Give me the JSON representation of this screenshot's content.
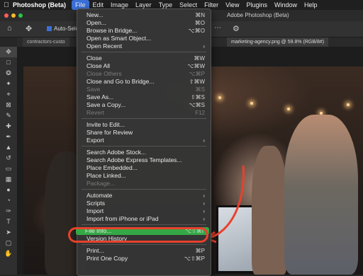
{
  "menubar": {
    "app_name": "Photoshop (Beta)",
    "items": [
      "File",
      "Edit",
      "Image",
      "Layer",
      "Type",
      "Select",
      "Filter",
      "View",
      "Plugins",
      "Window",
      "Help"
    ]
  },
  "window_title": "Adobe Photoshop (Beta)",
  "options_bar": {
    "auto_select_label": "Auto-Selec"
  },
  "tabs": [
    {
      "label": "contractors-custo"
    },
    {
      "label": "marketing-agency.png @ 59.8% (RGB/8#)"
    }
  ],
  "file_menu": {
    "groups": [
      [
        {
          "label": "New...",
          "shortcut": "⌘N"
        },
        {
          "label": "Open...",
          "shortcut": "⌘O"
        },
        {
          "label": "Browse in Bridge...",
          "shortcut": "⌥⌘O"
        },
        {
          "label": "Open as Smart Object...",
          "shortcut": ""
        },
        {
          "label": "Open Recent",
          "shortcut": "›"
        }
      ],
      [
        {
          "label": "Close",
          "shortcut": "⌘W"
        },
        {
          "label": "Close All",
          "shortcut": "⌥⌘W"
        },
        {
          "label": "Close Others",
          "shortcut": "⌥⌘P",
          "disabled": true
        },
        {
          "label": "Close and Go to Bridge...",
          "shortcut": "⇧⌘W"
        },
        {
          "label": "Save",
          "shortcut": "⌘S",
          "disabled": true
        },
        {
          "label": "Save As...",
          "shortcut": "⇧⌘S"
        },
        {
          "label": "Save a Copy...",
          "shortcut": "⌥⌘S"
        },
        {
          "label": "Revert",
          "shortcut": "F12",
          "disabled": true
        }
      ],
      [
        {
          "label": "Invite to Edit...",
          "shortcut": ""
        },
        {
          "label": "Share for Review",
          "shortcut": ""
        },
        {
          "label": "Export",
          "shortcut": "›"
        }
      ],
      [
        {
          "label": "Search Adobe Stock...",
          "shortcut": ""
        },
        {
          "label": "Search Adobe Express Templates...",
          "shortcut": ""
        },
        {
          "label": "Place Embedded...",
          "shortcut": ""
        },
        {
          "label": "Place Linked...",
          "shortcut": ""
        },
        {
          "label": "Package...",
          "shortcut": "",
          "disabled": true
        }
      ],
      [
        {
          "label": "Automate",
          "shortcut": "›"
        },
        {
          "label": "Scripts",
          "shortcut": "›"
        },
        {
          "label": "Import",
          "shortcut": "›"
        },
        {
          "label": "Import from iPhone or iPad",
          "shortcut": "›"
        }
      ],
      [
        {
          "label": "File Info...",
          "shortcut": "⌥⇧⌘I",
          "highlighted": true
        },
        {
          "label": "Version History",
          "shortcut": ""
        }
      ],
      [
        {
          "label": "Print...",
          "shortcut": "⌘P"
        },
        {
          "label": "Print One Copy",
          "shortcut": "⌥⇧⌘P"
        }
      ]
    ]
  },
  "tools": [
    "move-icon",
    "artboard-icon",
    "lasso-icon",
    "magic-wand-icon",
    "crop-icon",
    "frame-icon",
    "eyedropper-icon",
    "healing-icon",
    "brush-icon",
    "stamp-icon",
    "history-brush-icon",
    "eraser-icon",
    "gradient-icon",
    "blur-icon",
    "dodge-icon",
    "pen-icon",
    "type-icon",
    "path-select-icon",
    "rectangle-icon",
    "hand-icon"
  ],
  "colors": {
    "menu_active": "#3a6fd8",
    "highlight_green": "#35a845",
    "annotation_red": "#e8412c"
  }
}
